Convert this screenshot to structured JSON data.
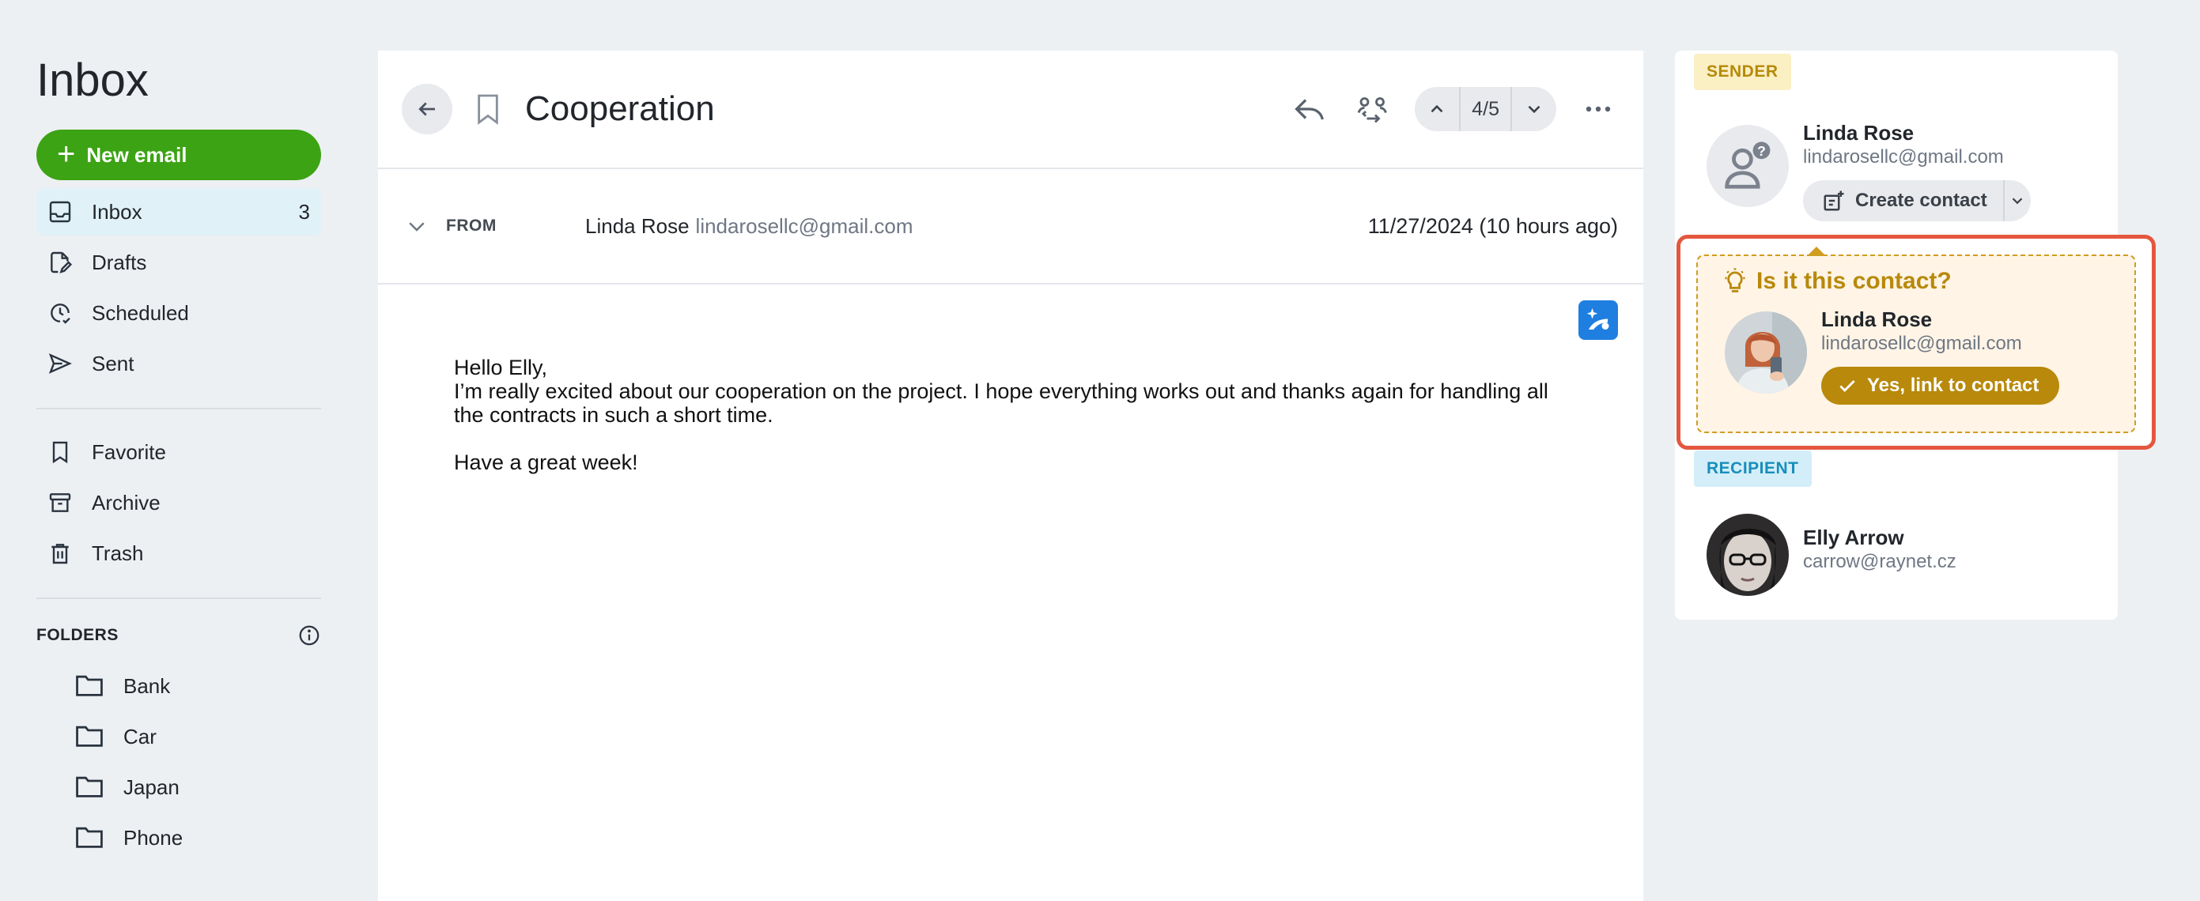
{
  "sidebar": {
    "title": "Inbox",
    "new_email_label": "New email",
    "nav": [
      {
        "label": "Inbox",
        "count": "3"
      },
      {
        "label": "Drafts"
      },
      {
        "label": "Scheduled"
      },
      {
        "label": "Sent"
      }
    ],
    "nav2": [
      {
        "label": "Favorite"
      },
      {
        "label": "Archive"
      },
      {
        "label": "Trash"
      }
    ],
    "folders_heading": "FOLDERS",
    "folders": [
      {
        "label": "Bank"
      },
      {
        "label": "Car"
      },
      {
        "label": "Japan"
      },
      {
        "label": "Phone"
      }
    ]
  },
  "email": {
    "subject": "Cooperation",
    "pager": "4/5",
    "from_label": "FROM",
    "from_name": "Linda Rose",
    "from_email": "lindarosellc@gmail.com",
    "date": "11/27/2024 (10 hours ago)",
    "body": {
      "greeting": "Hello Elly,",
      "paragraph": "I’m really excited about our cooperation on the project. I hope everything works out and thanks again for handling all the contracts in such a short time.",
      "closing": "Have a great week!"
    }
  },
  "panel": {
    "sender_badge": "SENDER",
    "sender_name": "Linda Rose",
    "sender_email": "lindarosellc@gmail.com",
    "create_contact_label": "Create contact",
    "suggestion": {
      "title": "Is it this contact?",
      "name": "Linda Rose",
      "email": "lindarosellc@gmail.com",
      "link_label": "Yes, link to contact"
    },
    "recipient_badge": "RECIPIENT",
    "recipient_name": "Elly Arrow",
    "recipient_email": "carrow@raynet.cz"
  },
  "colors": {
    "accent_green": "#3ca314",
    "highlight_red": "#e4573f",
    "suggest_gold": "#b8890a",
    "active_nav_bg": "#e0f1f7"
  },
  "icons": [
    "plus-icon",
    "inbox-icon",
    "drafts-icon",
    "scheduled-icon",
    "sent-icon",
    "bookmark-icon",
    "archive-icon",
    "trash-icon",
    "info-icon",
    "folder-icon",
    "back-arrow-icon",
    "reply-icon",
    "forward-people-icon",
    "chevron-up-icon",
    "chevron-down-icon",
    "more-icon",
    "ai-sparkle-icon",
    "add-contact-icon",
    "lightbulb-icon",
    "check-icon",
    "user-placeholder-icon"
  ]
}
